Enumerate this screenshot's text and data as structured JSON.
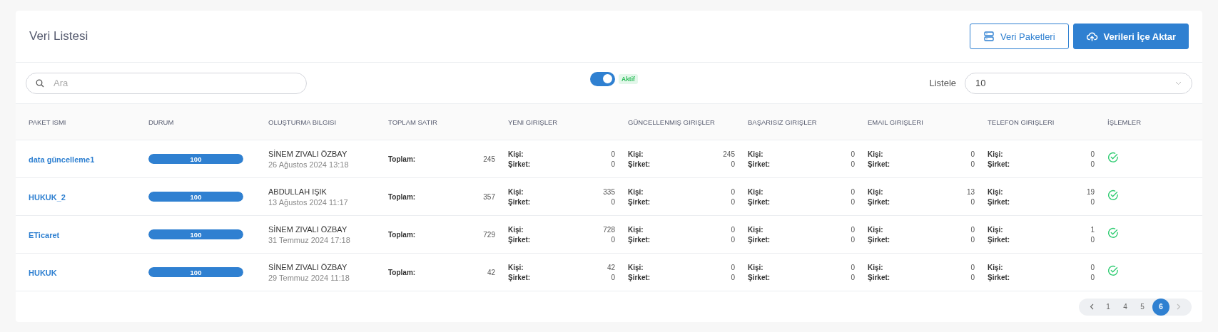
{
  "title": "Veri Listesi",
  "buttons": [
    {
      "kind": "outline",
      "label": "Veri Paketleri"
    },
    {
      "kind": "primary",
      "label": "Verileri İçe Aktar"
    }
  ],
  "search": {
    "placeholder": "Ara"
  },
  "toggle": {
    "on": true,
    "badge": "Aktif"
  },
  "page_size": {
    "label": "Listele",
    "value": "10"
  },
  "table": {
    "columns": [
      "PAKET ISMI",
      "DURUM",
      "OLUŞTURMA BILGISI",
      "TOPLAM SATIR",
      "YENI GIRIŞLER",
      "GÜNCELLENMIŞ GIRIŞLER",
      "BAŞARISIZ GIRIŞLER",
      "EMAIL GIRIŞLERI",
      "TELEFON GIRIŞLERI",
      "İŞLEMLER"
    ],
    "rows": [
      {
        "name": "data güncelleme1",
        "status": {
          "level": 1,
          "label": "100"
        },
        "creator": "SİNEM ZIVALI ÖZBAY",
        "date": "26 Ağustos 2024 13:18",
        "total_label": "Toplam:",
        "total": "245",
        "stats": [
          {
            "lines": [
              {
                "label": "Kişi:",
                "value": "0"
              },
              {
                "label": "Şirket:",
                "value": "0"
              }
            ]
          },
          {
            "lines": [
              {
                "label": "Kişi:",
                "value": "245"
              },
              {
                "label": "Şirket:",
                "value": "0"
              }
            ]
          },
          {
            "lines": [
              {
                "label": "Kişi:",
                "value": "0"
              },
              {
                "label": "Şirket:",
                "value": "0"
              }
            ]
          },
          {
            "lines": [
              {
                "label": "Kişi:",
                "value": "0"
              },
              {
                "label": "Şirket:",
                "value": "0"
              }
            ]
          },
          {
            "lines": [
              {
                "label": "Kişi:",
                "value": "0"
              },
              {
                "label": "Şirket:",
                "value": "0"
              }
            ]
          }
        ]
      },
      {
        "name": "HUKUK_2",
        "status": {
          "level": 1,
          "label": "100"
        },
        "creator": "ABDULLAH IŞIK",
        "date": "13 Ağustos 2024 11:17",
        "total_label": "Toplam:",
        "total": "357",
        "stats": [
          {
            "lines": [
              {
                "label": "Kişi:",
                "value": "335"
              },
              {
                "label": "Şirket:",
                "value": "0"
              }
            ]
          },
          {
            "lines": [
              {
                "label": "Kişi:",
                "value": "0"
              },
              {
                "label": "Şirket:",
                "value": "0"
              }
            ]
          },
          {
            "lines": [
              {
                "label": "Kişi:",
                "value": "0"
              },
              {
                "label": "Şirket:",
                "value": "0"
              }
            ]
          },
          {
            "lines": [
              {
                "label": "Kişi:",
                "value": "13"
              },
              {
                "label": "Şirket:",
                "value": "0"
              }
            ]
          },
          {
            "lines": [
              {
                "label": "Kişi:",
                "value": "19"
              },
              {
                "label": "Şirket:",
                "value": "0"
              }
            ]
          }
        ]
      },
      {
        "name": "ETicaret",
        "status": {
          "level": 1,
          "label": "100"
        },
        "creator": "SİNEM ZIVALI ÖZBAY",
        "date": "31 Temmuz 2024 17:18",
        "total_label": "Toplam:",
        "total": "729",
        "stats": [
          {
            "lines": [
              {
                "label": "Kişi:",
                "value": "728"
              },
              {
                "label": "Şirket:",
                "value": "0"
              }
            ]
          },
          {
            "lines": [
              {
                "label": "Kişi:",
                "value": "0"
              },
              {
                "label": "Şirket:",
                "value": "0"
              }
            ]
          },
          {
            "lines": [
              {
                "label": "Kişi:",
                "value": "0"
              },
              {
                "label": "Şirket:",
                "value": "0"
              }
            ]
          },
          {
            "lines": [
              {
                "label": "Kişi:",
                "value": "0"
              },
              {
                "label": "Şirket:",
                "value": "0"
              }
            ]
          },
          {
            "lines": [
              {
                "label": "Kişi:",
                "value": "1"
              },
              {
                "label": "Şirket:",
                "value": "0"
              }
            ]
          }
        ]
      },
      {
        "name": "HUKUK",
        "status": {
          "level": 1,
          "label": "100"
        },
        "creator": "SİNEM ZIVALI ÖZBAY",
        "date": "29 Temmuz 2024 11:18",
        "total_label": "Toplam:",
        "total": "42",
        "stats": [
          {
            "lines": [
              {
                "label": "Kişi:",
                "value": "42"
              },
              {
                "label": "Şirket:",
                "value": "0"
              }
            ]
          },
          {
            "lines": [
              {
                "label": "Kişi:",
                "value": "0"
              },
              {
                "label": "Şirket:",
                "value": "0"
              }
            ]
          },
          {
            "lines": [
              {
                "label": "Kişi:",
                "value": "0"
              },
              {
                "label": "Şirket:",
                "value": "0"
              }
            ]
          },
          {
            "lines": [
              {
                "label": "Kişi:",
                "value": "0"
              },
              {
                "label": "Şirket:",
                "value": "0"
              }
            ]
          },
          {
            "lines": [
              {
                "label": "Kişi:",
                "value": "0"
              },
              {
                "label": "Şirket:",
                "value": "0"
              }
            ]
          }
        ]
      }
    ]
  },
  "pagination": [
    {
      "label": "1",
      "selected": false
    },
    {
      "label": "4",
      "selected": false
    },
    {
      "label": "5",
      "selected": false
    },
    {
      "label": "6",
      "selected": true
    }
  ]
}
